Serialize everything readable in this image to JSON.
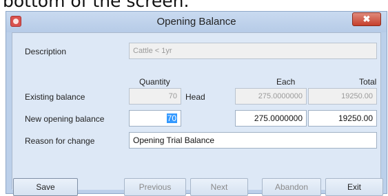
{
  "caption": "bottom of the screen.",
  "window": {
    "title": "Opening Balance",
    "close_glyph": "✖"
  },
  "form": {
    "description_label": "Description",
    "description_value": "Cattle < 1yr",
    "col_quantity": "Quantity",
    "col_each": "Each",
    "col_total": "Total",
    "existing_label": "Existing balance",
    "existing_quantity": "70",
    "existing_unit": "Head",
    "existing_each": "275.0000000",
    "existing_total": "19250.00",
    "new_label": "New opening balance",
    "new_quantity": "70",
    "new_each": "275.0000000",
    "new_total": "19250.00",
    "reason_label": "Reason for change",
    "reason_value": "Opening Trial Balance"
  },
  "buttons": {
    "save": "Save",
    "previous": "Previous",
    "next": "Next",
    "abandon": "Abandon",
    "exit": "Exit"
  },
  "icons": {
    "app": "app-icon",
    "close": "close-icon"
  },
  "colors": {
    "window_frame": "#bcd0ea",
    "panel": "#dde8f6",
    "close_button": "#c6402c",
    "selection": "#3399ff"
  }
}
